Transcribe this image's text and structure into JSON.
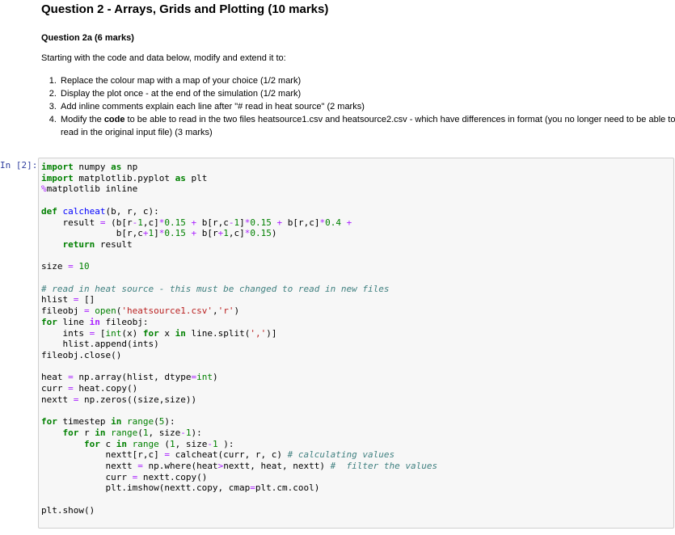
{
  "question": {
    "title": "Question 2 - Arrays, Grids and Plotting (10 marks)",
    "subtitle": "Question 2a (6 marks)",
    "intro": "Starting with the code and data below, modify and extend it to:",
    "tasks": [
      "Replace the colour map with a map of your choice (1/2 mark)",
      "Display the plot once - at the end of the simulation (1/2 mark)",
      "Add inline comments explain each line after \"# read in heat source\" (2 marks)"
    ],
    "task4_before": "Modify the ",
    "task4_bold": "code",
    "task4_after": " to be able to read in the two files heatsource1.csv and heatsource2.csv - which have differences in format (you no longer need to be able to read in the original input file) (3 marks)"
  },
  "cell": {
    "prompt": "In [2]:"
  }
}
